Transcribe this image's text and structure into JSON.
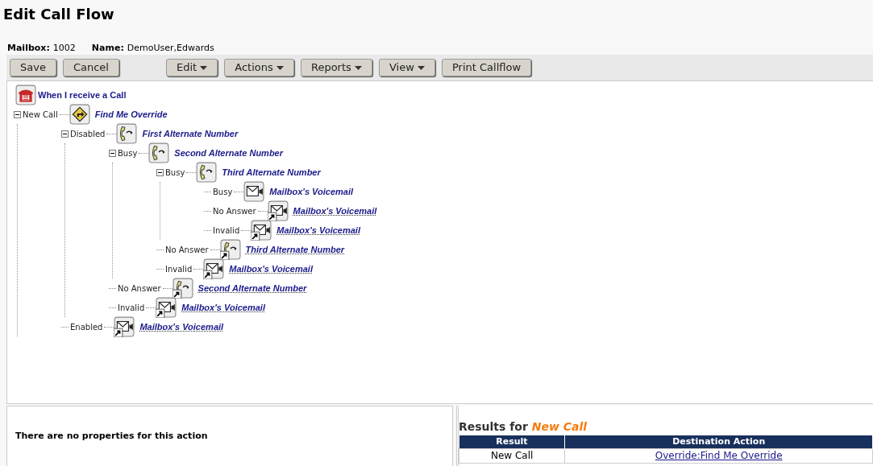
{
  "page_title": "Edit Call Flow",
  "mailbox": {
    "mailbox_label": "Mailbox:",
    "mailbox_value": "1002",
    "name_label": "Name:",
    "name_value": "DemoUser,Edwards"
  },
  "toolbar": [
    {
      "label": "Save",
      "dropdown": false
    },
    {
      "label": "Cancel",
      "dropdown": false
    },
    {
      "label": "Edit",
      "dropdown": true
    },
    {
      "label": "Actions",
      "dropdown": true
    },
    {
      "label": "Reports",
      "dropdown": true
    },
    {
      "label": "View",
      "dropdown": true
    },
    {
      "label": "Print Callflow",
      "dropdown": false
    }
  ],
  "tree": {
    "root": {
      "action": "When I receive a Call",
      "kind": "incoming"
    },
    "children": [
      {
        "branch": "New Call",
        "action": "Find Me Override",
        "kind": "findme",
        "shortcut": false,
        "expanded": true,
        "children": [
          {
            "branch": "Disabled",
            "action": "First Alternate Number",
            "kind": "altnumber",
            "shortcut": false,
            "expanded": true,
            "children": [
              {
                "branch": "Busy",
                "action": "Second Alternate Number",
                "kind": "altnumber",
                "shortcut": false,
                "expanded": true,
                "children": [
                  {
                    "branch": "Busy",
                    "action": "Third Alternate Number",
                    "kind": "altnumber",
                    "shortcut": false,
                    "expanded": true,
                    "children": [
                      {
                        "branch": "Busy",
                        "action": "Mailbox's Voicemail",
                        "kind": "voicemail",
                        "shortcut": false
                      },
                      {
                        "branch": "No Answer",
                        "action": "Mailbox's Voicemail",
                        "kind": "voicemail",
                        "shortcut": true
                      },
                      {
                        "branch": "Invalid",
                        "action": "Mailbox's Voicemail",
                        "kind": "voicemail",
                        "shortcut": true
                      }
                    ]
                  },
                  {
                    "branch": "No Answer",
                    "action": "Third Alternate Number",
                    "kind": "altnumber",
                    "shortcut": true
                  },
                  {
                    "branch": "Invalid",
                    "action": "Mailbox's Voicemail",
                    "kind": "voicemail",
                    "shortcut": true
                  }
                ]
              },
              {
                "branch": "No Answer",
                "action": "Second Alternate Number",
                "kind": "altnumber",
                "shortcut": true
              },
              {
                "branch": "Invalid",
                "action": "Mailbox's Voicemail",
                "kind": "voicemail",
                "shortcut": true
              }
            ]
          },
          {
            "branch": "Enabled",
            "action": "Mailbox's Voicemail",
            "kind": "voicemail",
            "shortcut": true
          }
        ]
      }
    ]
  },
  "properties": {
    "message": "There are no properties for this action"
  },
  "results": {
    "title_prefix": "Results for",
    "title_subject": "New Call",
    "columns": [
      "Result",
      "Destination Action"
    ],
    "rows": [
      {
        "result": "New Call",
        "destination": "Override:Find Me Override"
      }
    ]
  }
}
